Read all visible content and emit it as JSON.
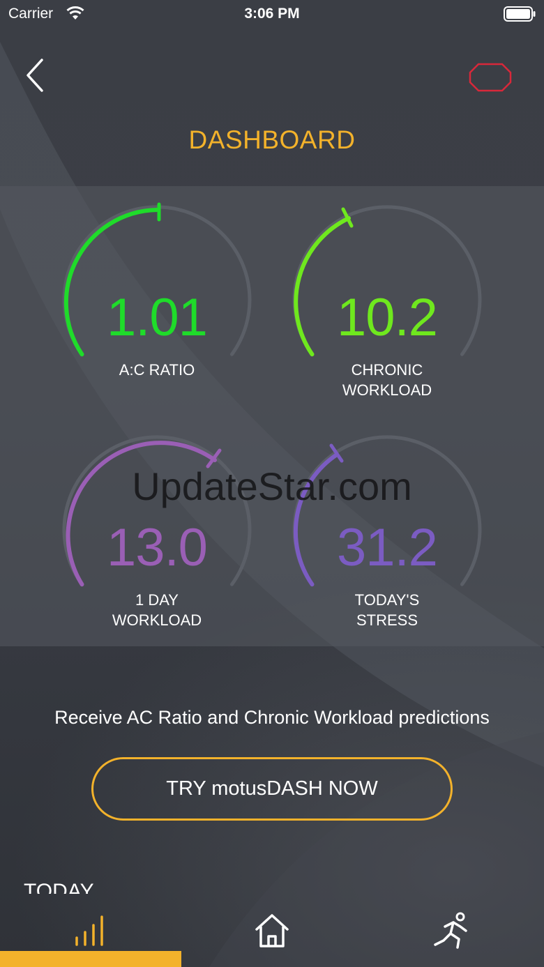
{
  "status_bar": {
    "carrier": "Carrier",
    "time": "3:06 PM"
  },
  "header": {
    "title": "DASHBOARD",
    "accent_color": "#f3b22b",
    "badge_color": "#d8283a"
  },
  "gauges": [
    {
      "value": "1.01",
      "label_line1": "A:C RATIO",
      "label_line2": "",
      "color": "#1fdc2a",
      "fill_fraction": 0.5
    },
    {
      "value": "10.2",
      "label_line1": "CHRONIC",
      "label_line2": "WORKLOAD",
      "color": "#6fe81e",
      "fill_fraction": 0.3
    },
    {
      "value": "13.0",
      "label_line1": "1 DAY",
      "label_line2": "WORKLOAD",
      "color": "#9a5fb5",
      "fill_fraction": 0.75
    },
    {
      "value": "31.2",
      "label_line1": "TODAY'S",
      "label_line2": "STRESS",
      "color": "#7b5cc2",
      "fill_fraction": 0.25
    }
  ],
  "watermark": "UpdateStar.com",
  "promo": {
    "text": "Receive AC Ratio and Chronic Workload predictions",
    "button_label": "TRY motusDASH NOW"
  },
  "section": {
    "today": "TODAY"
  },
  "tab_bar": {
    "tabs": [
      {
        "icon": "bar-chart-icon",
        "active": true
      },
      {
        "icon": "home-icon",
        "active": false
      },
      {
        "icon": "runner-icon",
        "active": false
      }
    ],
    "active_color": "#f3b22b"
  }
}
